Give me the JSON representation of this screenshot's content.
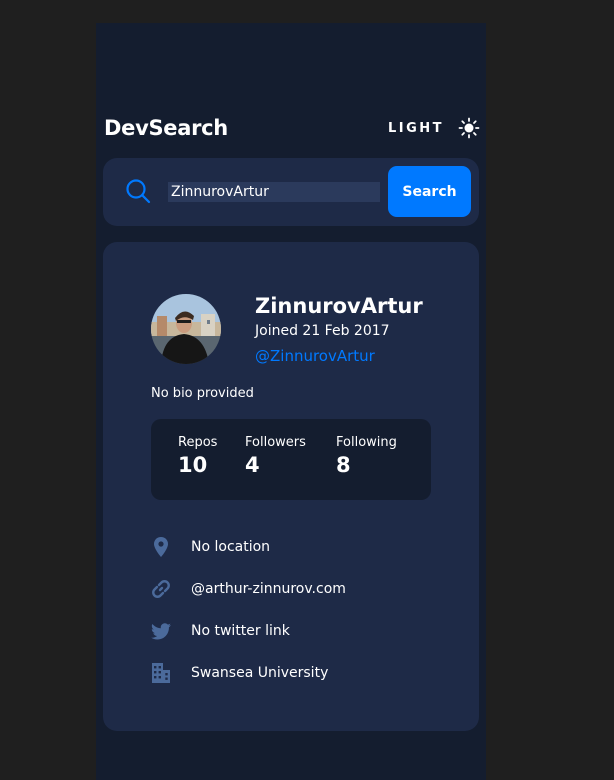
{
  "app": {
    "title": "DevSearch"
  },
  "theme_toggle": {
    "label": "LIGHT",
    "icon": "sun-icon"
  },
  "search": {
    "value": "ZinnurovArtur",
    "button_label": "Search",
    "icon": "search-icon"
  },
  "profile": {
    "name": "ZinnurovArtur",
    "joined": "Joined 21 Feb 2017",
    "login": "@ZinnurovArtur",
    "bio": "No bio provided",
    "stats": [
      {
        "label": "Repos",
        "value": "10"
      },
      {
        "label": "Followers",
        "value": "4"
      },
      {
        "label": "Following",
        "value": "8"
      }
    ],
    "links": {
      "location": {
        "text": "No location",
        "icon": "location-pin-icon"
      },
      "website": {
        "text": "@arthur-zinnurov.com",
        "icon": "link-icon"
      },
      "twitter": {
        "text": "No twitter link",
        "icon": "twitter-icon"
      },
      "company": {
        "text": "Swansea University",
        "icon": "building-icon"
      }
    }
  },
  "colors": {
    "page_bg": "#1f1f1f",
    "app_bg": "#141d2f",
    "card_bg": "#1e2a47",
    "accent": "#0079ff",
    "icon_muted": "#4b6a9b",
    "text": "#ffffff"
  }
}
